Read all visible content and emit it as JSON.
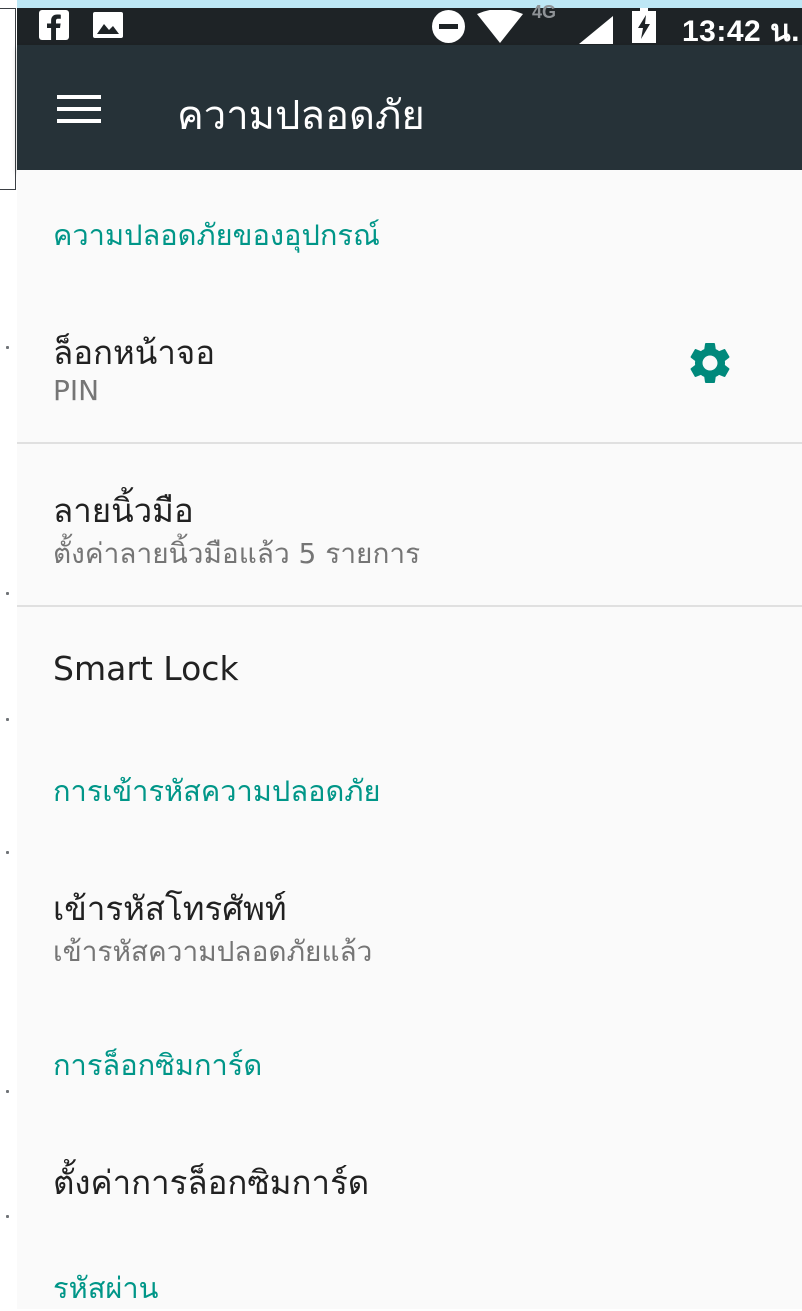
{
  "status_bar": {
    "network_label": "4G",
    "time": "13:42 น.",
    "icons": [
      "facebook-icon",
      "image-icon",
      "do-not-disturb-icon",
      "wifi-icon",
      "signal-icon",
      "battery-charging-icon"
    ]
  },
  "app_bar": {
    "title": "ความปลอดภัย",
    "menu_icon": "hamburger-menu-icon"
  },
  "sections": {
    "device_security": {
      "header": "ความปลอดภัยของอุปกรณ์",
      "screen_lock": {
        "title": "ล็อกหน้าจอ",
        "summary": "PIN",
        "settings_icon": "gear-icon"
      },
      "fingerprint": {
        "title": "ลายนิ้วมือ",
        "summary": "ตั้งค่าลายนิ้วมือแล้ว 5 รายการ"
      },
      "smart_lock": {
        "title": "Smart Lock"
      }
    },
    "encryption": {
      "header": "การเข้ารหัสความปลอดภัย",
      "encrypt_phone": {
        "title": "เข้ารหัสโทรศัพท์",
        "summary": "เข้ารหัสความปลอดภัยแล้ว"
      }
    },
    "sim_lock": {
      "header": "การล็อกซิมการ์ด",
      "setup": {
        "title": "ตั้งค่าการล็อกซิมการ์ด"
      }
    },
    "passwords": {
      "header": "รหัสผ่าน"
    }
  },
  "colors": {
    "accent": "#009688",
    "app_bar": "#263238",
    "status_bar": "#1e2326",
    "background": "#fafafa"
  }
}
